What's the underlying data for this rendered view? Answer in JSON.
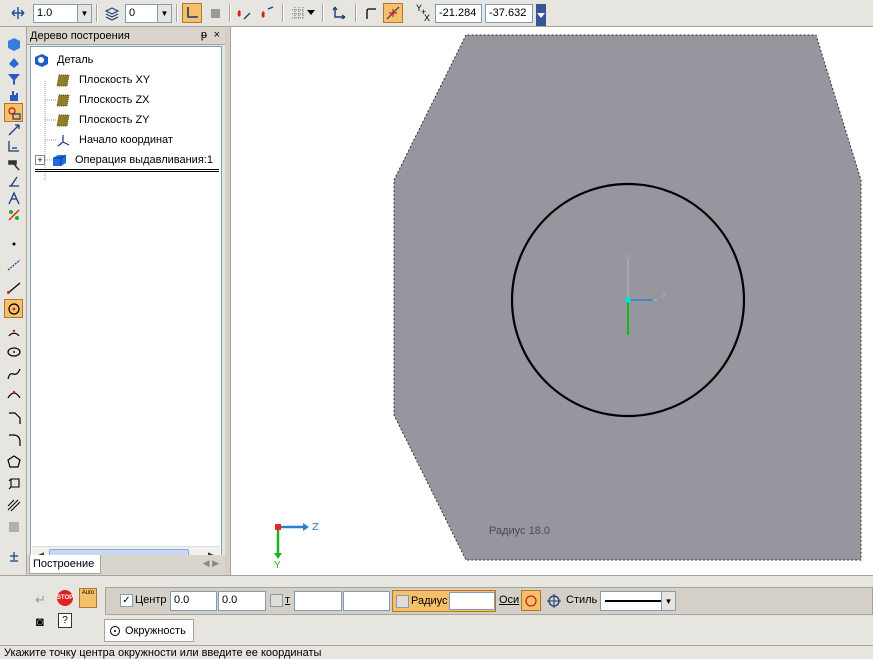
{
  "toolbar": {
    "scale_value": "1.0",
    "layer_value": "0",
    "coord_x": "-21.284",
    "coord_y": "-37.632",
    "coord_label_y": "Y",
    "coord_label_x": "X"
  },
  "tree": {
    "title": "Дерево построения",
    "items": [
      {
        "label": "Деталь"
      },
      {
        "label": "Плоскость XY"
      },
      {
        "label": "Плоскость ZX"
      },
      {
        "label": "Плоскость ZY"
      },
      {
        "label": "Начало координат"
      },
      {
        "label": "Операция выдавливания:1"
      }
    ],
    "expand_symbol": "+",
    "tab_label": "Построение"
  },
  "canvas": {
    "radius_hint": "Радиус 18.0",
    "axis_y_label": "Y",
    "axis_x_label": "X",
    "axis_z_label": "Z",
    "corner_y_label": "Y",
    "shape_fill": "#96969e",
    "circle_stroke": "#000000",
    "origin_marker": "#00e0e0"
  },
  "propbar": {
    "center_label": "Центр",
    "center_x": "0.0",
    "center_y": "0.0",
    "t_label": "т",
    "t_value1": "",
    "t_value2": "",
    "radius_label": "Радиус",
    "radius_value": "",
    "axes_label": "Оси",
    "style_label": "Стиль",
    "tab_label": "Окружность",
    "stop_label": "STOP",
    "auto_label": "Auto",
    "accent_color": "#f5c06a"
  },
  "status": {
    "message": "Укажите точку центра окружности или введите ее координаты"
  }
}
